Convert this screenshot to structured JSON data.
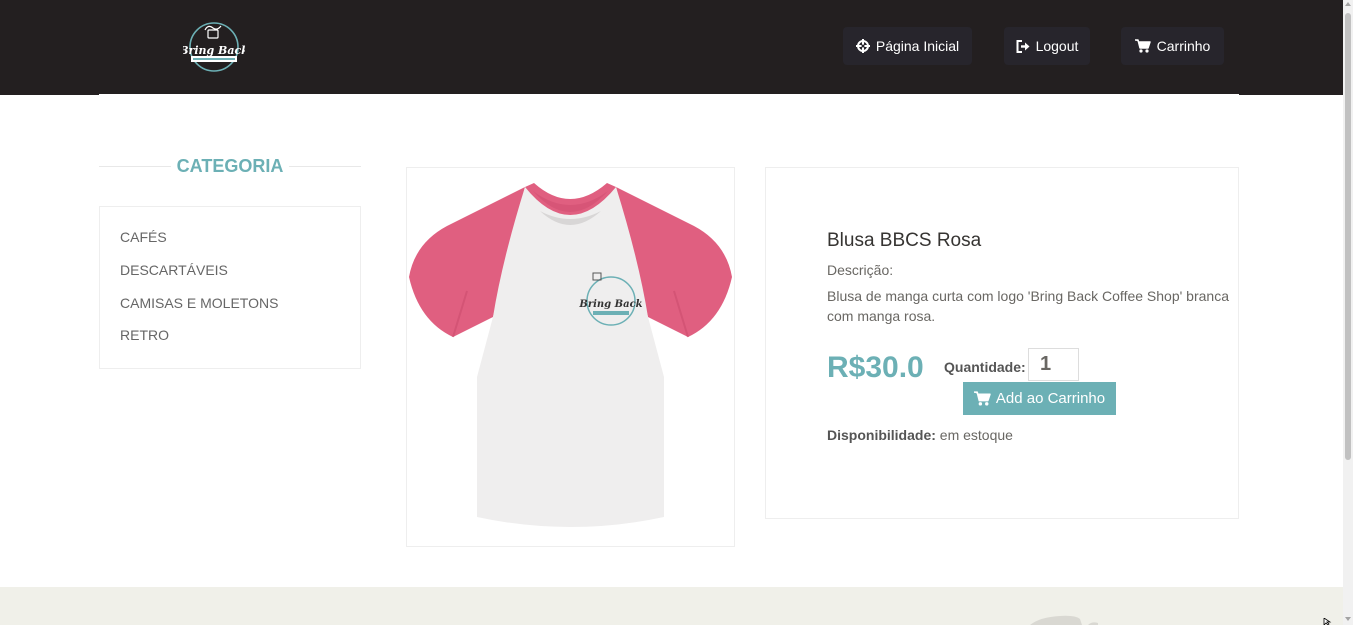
{
  "header": {
    "logo_text": "Bring Back",
    "nav": [
      {
        "label": "Página Inicial",
        "icon": "crosshairs-icon"
      },
      {
        "label": "Logout",
        "icon": "sign-out-icon"
      },
      {
        "label": "Carrinho",
        "icon": "shopping-cart-icon"
      }
    ]
  },
  "sidebar": {
    "title": "CATEGORIA",
    "items": [
      {
        "label": "CAFÉS"
      },
      {
        "label": "DESCARTÁVEIS"
      },
      {
        "label": "CAMISAS E MOLETONS"
      },
      {
        "label": "RETRO"
      }
    ]
  },
  "product": {
    "name": "Blusa BBCS Rosa",
    "description_label": "Descrição:",
    "description": "Blusa de manga curta com logo 'Bring Back Coffee Shop' branca com manga rosa.",
    "price": "R$30.0",
    "quantity_label": "Quantidade:",
    "quantity": "1",
    "add_button_label": "Add ao Carrinho",
    "availability_label": "Disponibilidade:",
    "availability": "em estoque",
    "image_logo_text": "Bring Back"
  },
  "colors": {
    "header_bg": "#231f20",
    "accent": "#6cb0b5",
    "sleeve_pink": "#e05f80",
    "footer_bg": "#f0f0e9"
  }
}
